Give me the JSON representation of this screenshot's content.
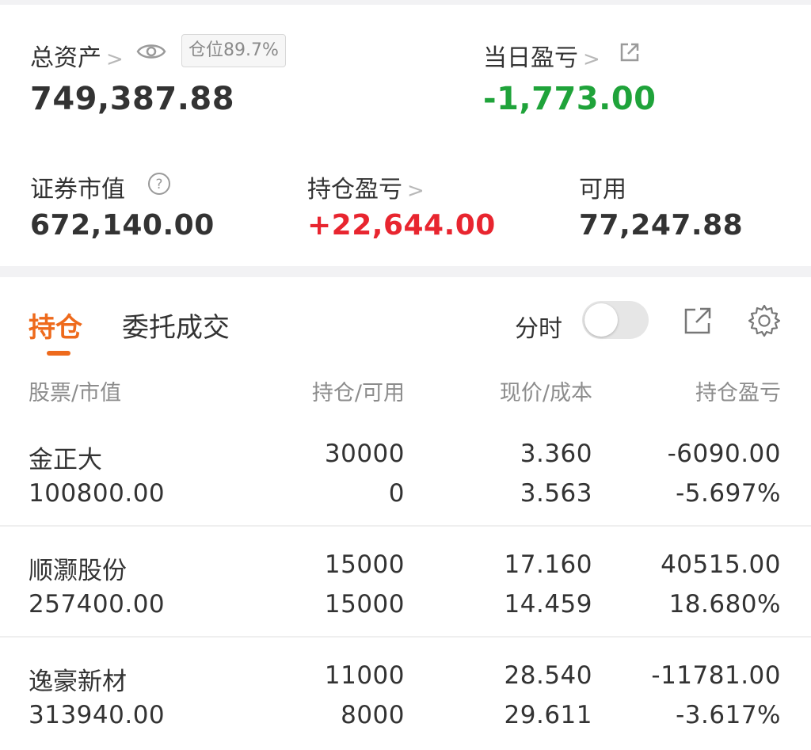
{
  "summary": {
    "total_assets_label": "总资产",
    "position_badge": "仓位89.7%",
    "total_assets_value": "749,387.88",
    "daily_pl_label": "当日盈亏",
    "daily_pl_value": "-1,773.00",
    "market_value_label": "证券市值",
    "market_value_value": "672,140.00",
    "holding_pl_label": "持仓盈亏",
    "holding_pl_value": "+22,644.00",
    "available_label": "可用",
    "available_value": "77,247.88"
  },
  "tabs": [
    {
      "label": "持仓"
    },
    {
      "label": "委托成交"
    }
  ],
  "toolbar": {
    "intraday_label": "分时"
  },
  "columns": {
    "stock": "股票/市值",
    "position": "持仓/可用",
    "price": "现价/成本",
    "pl": "持仓盈亏"
  },
  "rows": [
    {
      "name": "金正大",
      "market_value": "100800.00",
      "position": "30000",
      "available": "0",
      "price": "3.360",
      "cost": "3.563",
      "pl": "-6090.00",
      "pl_pct": "-5.697%",
      "trend": "down"
    },
    {
      "name": "顺灏股份",
      "market_value": "257400.00",
      "position": "15000",
      "available": "15000",
      "price": "17.160",
      "cost": "14.459",
      "pl": "40515.00",
      "pl_pct": "18.680%",
      "trend": "up"
    },
    {
      "name": "逸豪新材",
      "market_value": "313940.00",
      "position": "11000",
      "available": "8000",
      "price": "28.540",
      "cost": "29.611",
      "pl": "-11781.00",
      "pl_pct": "-3.617%",
      "trend": "down"
    }
  ],
  "colors": {
    "accent": "#ee6a1c",
    "gain": "#e8252f",
    "loss": "#1fa33a"
  }
}
